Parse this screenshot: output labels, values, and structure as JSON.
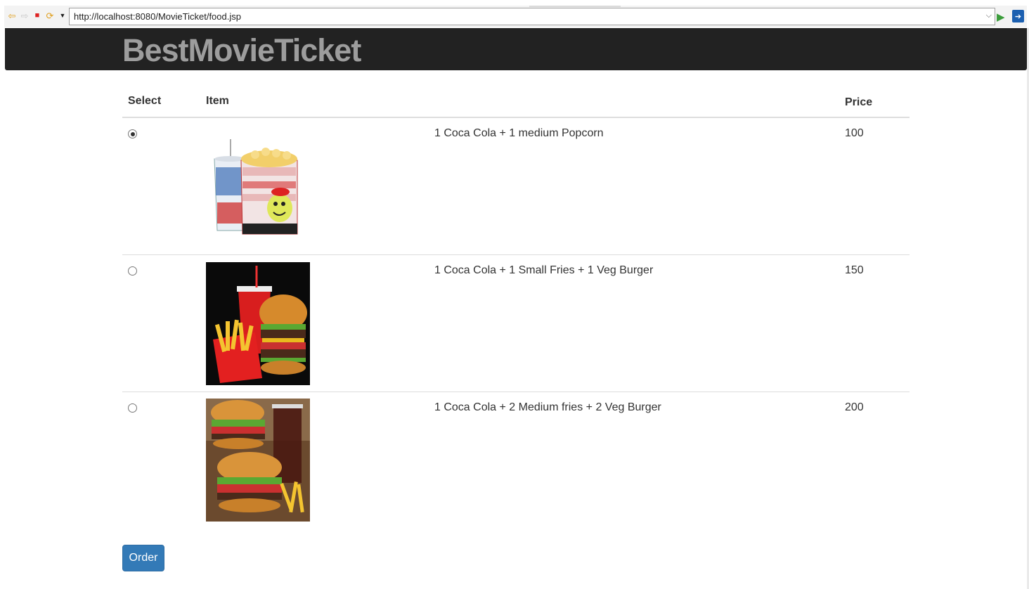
{
  "browser": {
    "url": "http://localhost:8080/MovieTicket/food.jsp",
    "icons": [
      "back-icon",
      "forward-icon",
      "stop-icon",
      "refresh-icon",
      "dropdown-icon",
      "go-icon",
      "extension-icon"
    ]
  },
  "header": {
    "brand": "BestMovieTicket"
  },
  "table": {
    "headers": {
      "select": "Select",
      "item": "Item",
      "price": "Price"
    },
    "rows": [
      {
        "selected": true,
        "description": "1 Coca Cola + 1 medium Popcorn",
        "price": "100"
      },
      {
        "selected": false,
        "description": "1 Coca Cola + 1 Small Fries + 1 Veg Burger",
        "price": "150"
      },
      {
        "selected": false,
        "description": "1 Coca Cola + 2 Medium fries + 2 Veg Burger",
        "price": "200"
      }
    ]
  },
  "actions": {
    "order_label": "Order"
  },
  "colors": {
    "header_bg": "#222222",
    "brand_text": "#9d9d9d",
    "button_primary": "#337ab7"
  }
}
